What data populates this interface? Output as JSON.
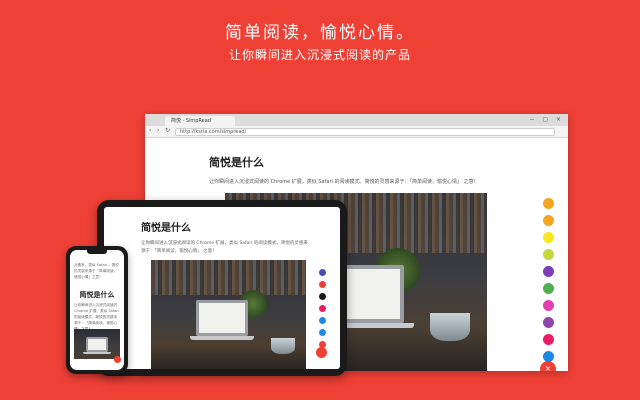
{
  "hero": {
    "title": "简单阅读，愉悦心情。",
    "subtitle": "让你瞬间进入沉浸式阅读的产品"
  },
  "browser": {
    "tab_title": "简悦 · SimpRead",
    "url": "http://ksria.com/simpread/",
    "nav_back_icon": "‹",
    "nav_forward_icon": "›",
    "reload_icon": "↻",
    "window_controls": "− ▢ ×",
    "article_title": "简悦是什么",
    "article_text": "让你瞬间进入沉浸式阅读的 Chrome 扩展，类似 Safari 的阅读模式。简悦的灵感来源于：「简单阅读，愉悦心情」 之意！",
    "side_buttons": [
      {
        "name": "pin-icon",
        "color": "#f5a623"
      },
      {
        "name": "setting-icon",
        "color": "#f5a623"
      },
      {
        "name": "font-icon",
        "color": "#f8e71c"
      },
      {
        "name": "layout-icon",
        "color": "#c3d93d"
      },
      {
        "name": "theme-icon",
        "color": "#7b3fb7"
      },
      {
        "name": "share-icon",
        "color": "#4caf50"
      },
      {
        "name": "send-icon",
        "color": "#e040b0"
      },
      {
        "name": "cloud-icon",
        "color": "#8e44ad"
      },
      {
        "name": "download-icon",
        "color": "#e91e63"
      },
      {
        "name": "link-icon",
        "color": "#1e88e5"
      },
      {
        "name": "more-icon",
        "color": "#ff8a80"
      }
    ],
    "close_icon": "×"
  },
  "tablet": {
    "article_title": "简悦是什么",
    "article_text": "让你瞬间进入沉浸式阅读的 Chrome 扩展，类似 Safari 的阅读模式。简悦的灵感来源于：「简单阅读，愉悦心情」 之意！",
    "side_colors": [
      "#3f51b5",
      "#ef4036",
      "#1a1a1a",
      "#e91e63",
      "#1e88e5",
      "#1e88e5",
      "#ef4036"
    ]
  },
  "phone": {
    "intro_text": "元素来，类似 Safari... 简悦的灵感来源于「简单阅读，愉悦心情」之意！",
    "article_title": "简悦是什么",
    "article_text": "让你瞬间进入沉浸式阅读的 Chrome 扩展，类似 Safari 的阅读模式。简悦的灵感来源于：「简单阅读，愉悦心情」之意！"
  },
  "colors": {
    "background": "#ef4036",
    "accent": "#ef4036"
  }
}
